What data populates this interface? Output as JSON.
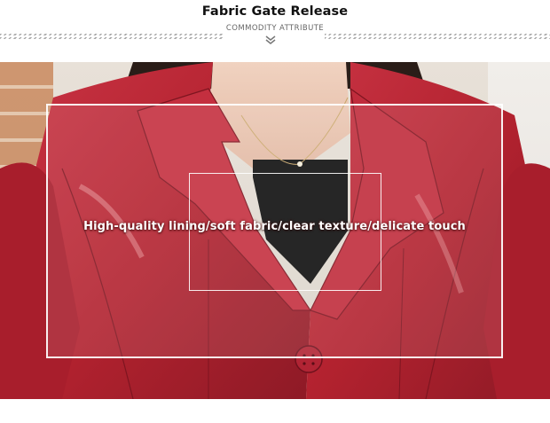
{
  "header": {
    "title": "Fabric Gate Release",
    "subtitle": "COMMODITY ATTRIBUTE",
    "divider_icon": "double-chevron-down-icon"
  },
  "banner": {
    "caption": "High-quality lining/soft fabric/clear texture/delicate touch"
  },
  "colors": {
    "jacket": "#b3222f",
    "shirt": "#111111",
    "frame": "#ffffff"
  }
}
